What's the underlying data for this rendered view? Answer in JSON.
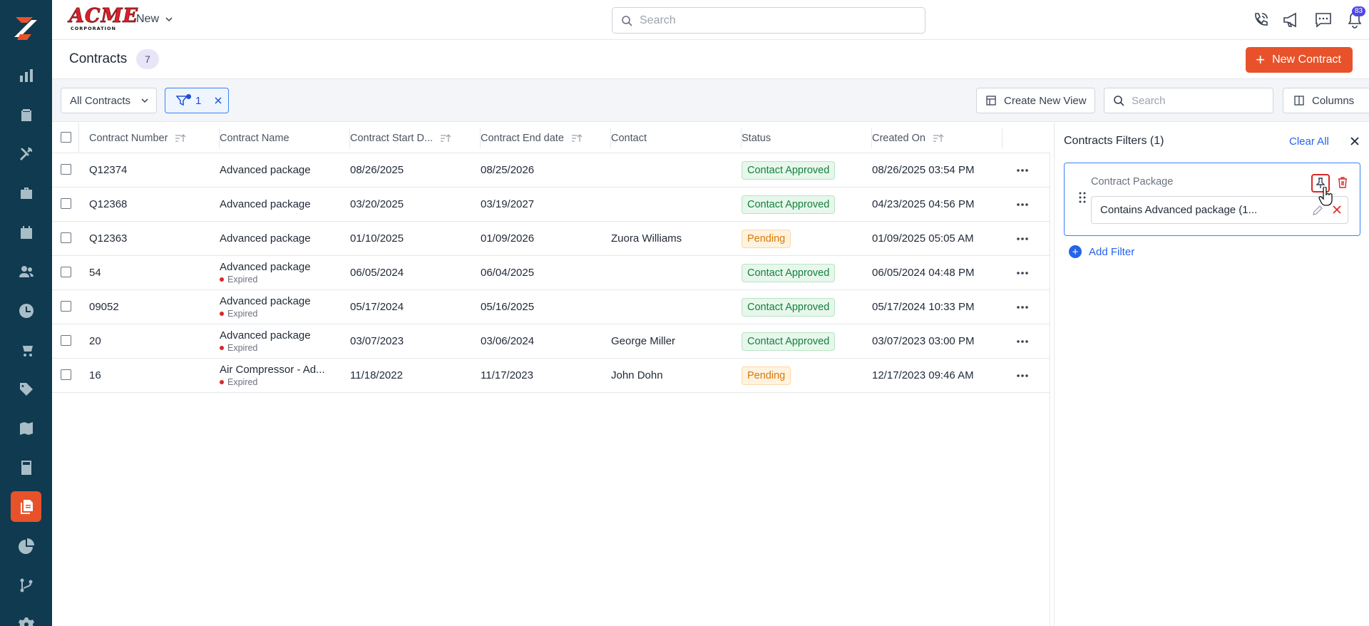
{
  "brand": {
    "name": "ACME",
    "sub": "CORPORATION"
  },
  "topbar": {
    "new_label": "New",
    "search_placeholder": "Search",
    "notification_count": "83"
  },
  "page": {
    "title": "Contracts",
    "count": "7",
    "new_button": "New Contract"
  },
  "toolbar": {
    "view": "All Contracts",
    "filter_count": "1",
    "create_view": "Create New View",
    "search_placeholder": "Search",
    "columns": "Columns"
  },
  "table": {
    "headers": [
      "Contract Number",
      "Contract Name",
      "Contract Start D...",
      "Contract End date",
      "Contact",
      "Status",
      "Created On"
    ],
    "rows": [
      {
        "number": "Q12374",
        "name": "Advanced package",
        "expired": "",
        "start": "08/26/2025",
        "end": "08/25/2026",
        "contact": "",
        "status": "Contact Approved",
        "created": "08/26/2025 03:54 PM"
      },
      {
        "number": "Q12368",
        "name": "Advanced package",
        "expired": "",
        "start": "03/20/2025",
        "end": "03/19/2027",
        "contact": "",
        "status": "Contact Approved",
        "created": "04/23/2025 04:56 PM"
      },
      {
        "number": "Q12363",
        "name": "Advanced package",
        "expired": "",
        "start": "01/10/2025",
        "end": "01/09/2026",
        "contact": "Zuora Williams",
        "status": "Pending",
        "created": "01/09/2025 05:05 AM"
      },
      {
        "number": "54",
        "name": "Advanced package",
        "expired": "Expired",
        "start": "06/05/2024",
        "end": "06/04/2025",
        "contact": "",
        "status": "Contact Approved",
        "created": "06/05/2024 04:48 PM"
      },
      {
        "number": "09052",
        "name": "Advanced package",
        "expired": "Expired",
        "start": "05/17/2024",
        "end": "05/16/2025",
        "contact": "",
        "status": "Contact Approved",
        "created": "05/17/2024 10:33 PM"
      },
      {
        "number": "20",
        "name": "Advanced package",
        "expired": "Expired",
        "start": "03/07/2023",
        "end": "03/06/2024",
        "contact": "George Miller",
        "status": "Contact Approved",
        "created": "03/07/2023 03:00 PM"
      },
      {
        "number": "16",
        "name": "Air Compressor - Ad...",
        "expired": "Expired",
        "start": "11/18/2022",
        "end": "11/17/2023",
        "contact": "John Dohn",
        "status": "Pending",
        "created": "12/17/2023 09:46 AM"
      }
    ]
  },
  "filters_panel": {
    "title": "Contracts Filters (1)",
    "clear_all": "Clear All",
    "filter_label": "Contract Package",
    "filter_value": "Contains Advanced package (1...",
    "add_filter": "Add Filter"
  },
  "sidebar": {
    "items": [
      "dashboard",
      "clipboard",
      "tools",
      "briefcase",
      "calendar",
      "users",
      "clock",
      "cart",
      "tag",
      "map",
      "calculator",
      "contracts",
      "pie-chart",
      "branch",
      "settings"
    ],
    "active": "contracts"
  },
  "colors": {
    "sidebar": "#0f3a4f",
    "accent": "#e8522a",
    "link": "#2563eb",
    "approved": "#15803d",
    "pending": "#d97706"
  }
}
